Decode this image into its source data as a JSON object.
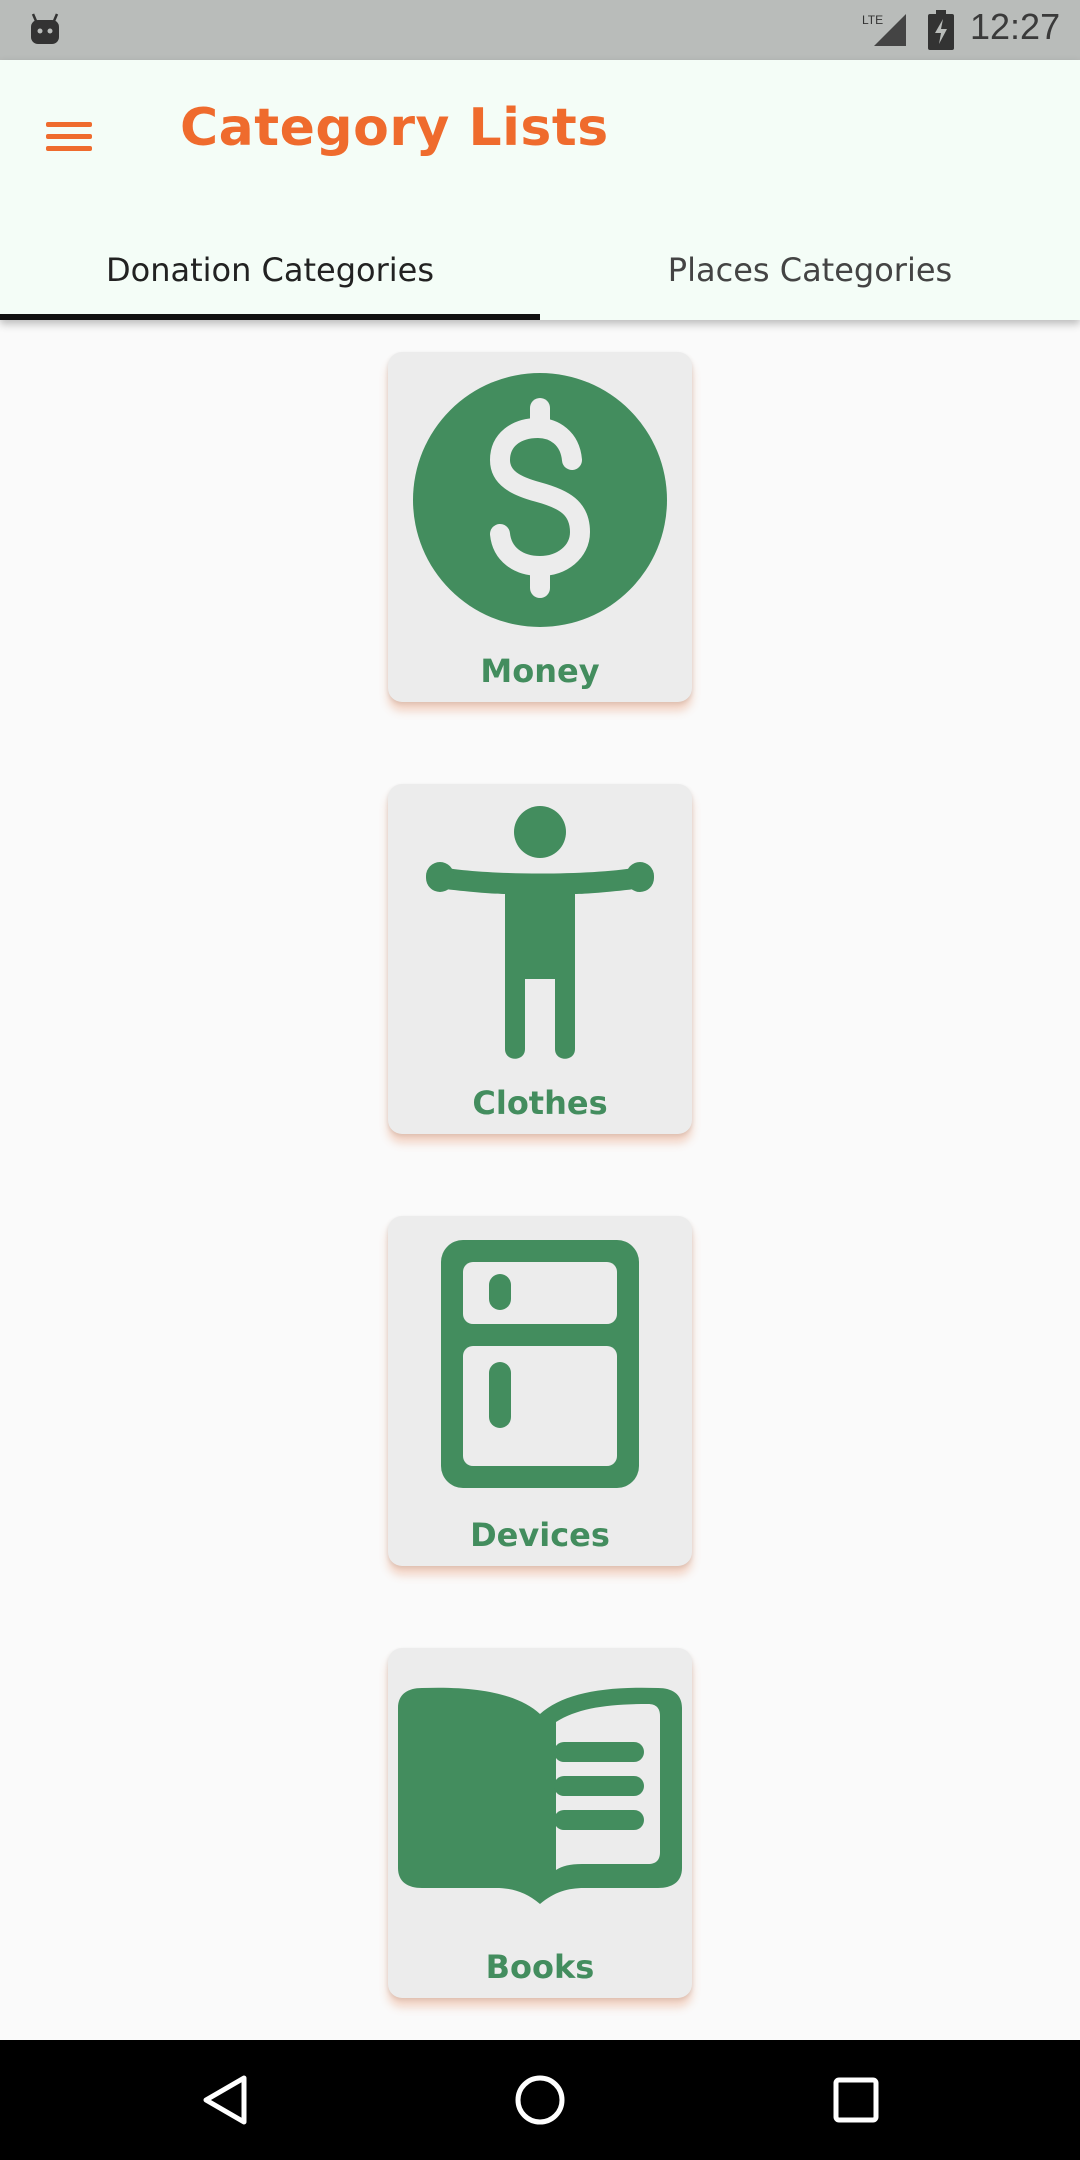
{
  "status_bar": {
    "time": "12:27",
    "network": "LTE",
    "icons": [
      "android-robot-icon",
      "lte-signal-icon",
      "battery-charging-icon"
    ]
  },
  "app_bar": {
    "title": "Category Lists",
    "menu_icon": "hamburger-menu-icon"
  },
  "tabs": [
    {
      "label": "Donation Categories",
      "active": true
    },
    {
      "label": "Places Categories",
      "active": false
    }
  ],
  "categories": [
    {
      "label": "Money",
      "icon": "dollar-icon"
    },
    {
      "label": "Clothes",
      "icon": "person-icon"
    },
    {
      "label": "Devices",
      "icon": "fridge-icon"
    },
    {
      "label": "Books",
      "icon": "book-icon"
    }
  ],
  "nav_bar": {
    "icons": [
      "back-icon",
      "home-icon",
      "recents-icon"
    ]
  },
  "colors": {
    "accent": "#ef6b2d",
    "icon_green": "#438d5e",
    "app_bar_bg": "#f4fdf7",
    "card_bg": "#ececec"
  }
}
